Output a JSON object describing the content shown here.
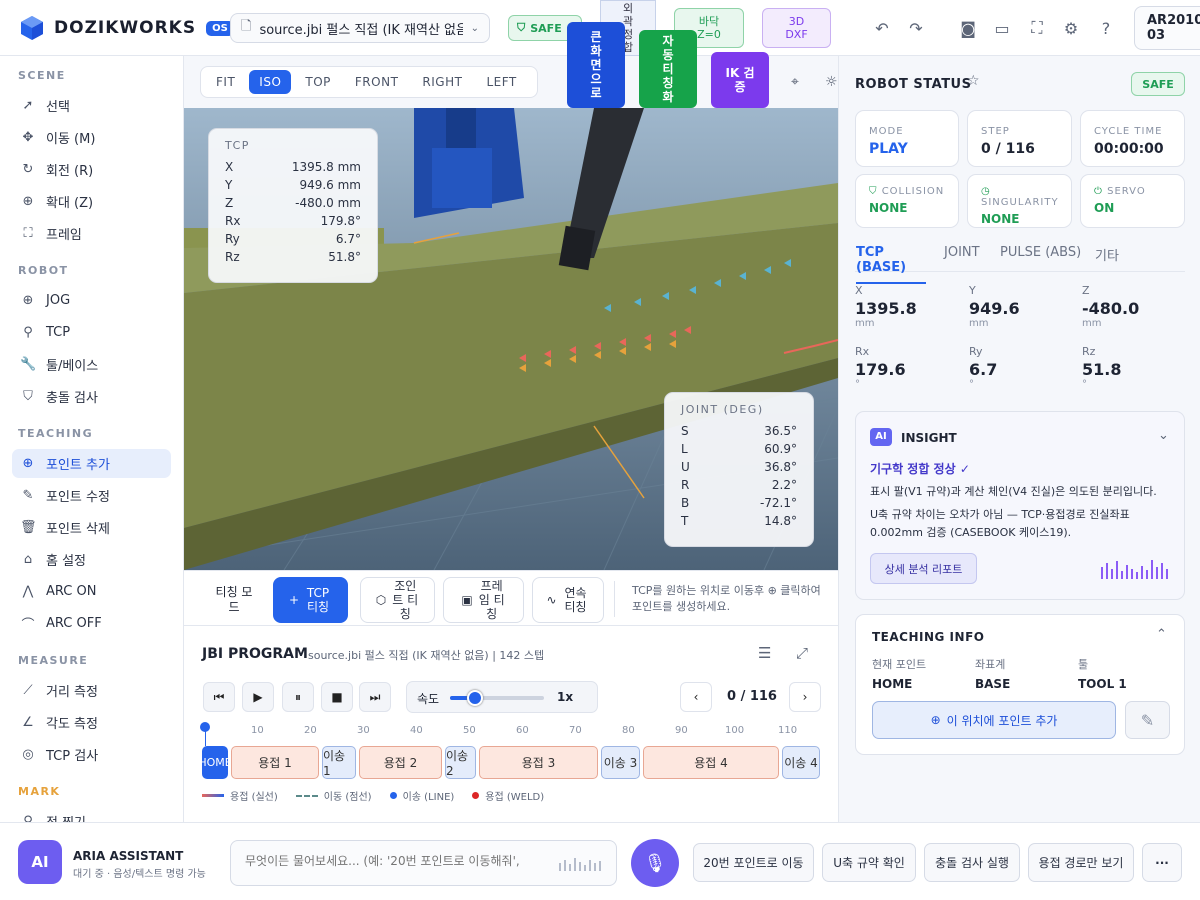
{
  "header": {
    "app_title": "DOZIKWORKS",
    "version": "OS",
    "file_name": "source.jbi 펄스 직접 (IK 재역산 없음)",
    "safe_label": "SAFE",
    "chip_outline": "외곽 정합",
    "chip_floor": "바닥 Z=0",
    "chip_3d": "3D DXF",
    "model": "AR2010 03",
    "float_btn1": "큰화면으로",
    "float_btn2": "자동티칭화",
    "float_btn3": "IK 검증"
  },
  "sidebar": {
    "sections": [
      {
        "title": "SCENE",
        "items": [
          "선택",
          "이동 (M)",
          "회전 (R)",
          "확대 (Z)",
          "프레임"
        ]
      },
      {
        "title": "ROBOT",
        "items": [
          "JOG",
          "TCP",
          "툴/베이스",
          "충돌 검사"
        ]
      },
      {
        "title": "TEACHING",
        "items": [
          "포인트 추가",
          "포인트 수정",
          "포인트 삭제",
          "홈 설정",
          "ARC ON",
          "ARC OFF"
        ]
      },
      {
        "title": "MEASURE",
        "items": [
          "거리 측정",
          "각도 측정",
          "TCP 검사"
        ]
      },
      {
        "title": "MARK",
        "items": [
          "점 찍기"
        ]
      }
    ]
  },
  "viewbar": {
    "items": [
      "FIT",
      "ISO",
      "TOP",
      "FRONT",
      "RIGHT",
      "LEFT"
    ],
    "active": "ISO"
  },
  "tcp_overlay": {
    "title": "TCP",
    "rows": [
      {
        "k": "X",
        "v": "1395.8 mm"
      },
      {
        "k": "Y",
        "v": "949.6 mm"
      },
      {
        "k": "Z",
        "v": "-480.0 mm"
      },
      {
        "k": "Rx",
        "v": "179.8°"
      },
      {
        "k": "Ry",
        "v": "6.7°"
      },
      {
        "k": "Rz",
        "v": "51.8°"
      }
    ]
  },
  "joint_overlay": {
    "title": "JOINT (DEG)",
    "rows": [
      {
        "k": "S",
        "v": "36.5°"
      },
      {
        "k": "L",
        "v": "60.9°"
      },
      {
        "k": "U",
        "v": "36.8°"
      },
      {
        "k": "R",
        "v": "2.2°"
      },
      {
        "k": "B",
        "v": "-72.1°"
      },
      {
        "k": "T",
        "v": "14.8°"
      }
    ]
  },
  "teach_bar": {
    "mode_label": "티칭 모드",
    "tcp_btn": "TCP 티칭",
    "joint_btn": "조인트 티칭",
    "frame_btn": "프레임 티칭",
    "cont_btn": "연속 티칭",
    "hint": "TCP를 원하는 위치로 이동후 ⊕ 클릭하여 포인트를 생성하세요."
  },
  "program": {
    "title": "JBI PROGRAM",
    "subtitle": "source.jbi 펄스 직접 (IK 재역산 없음) | 142 스텝",
    "speed_label": "속도",
    "speed_value": "1x",
    "speed": 0.27,
    "position": "0 / 116",
    "ticks": [
      "10",
      "20",
      "30",
      "40",
      "50",
      "60",
      "70",
      "80",
      "90",
      "100",
      "110"
    ],
    "segments": [
      "HOME",
      "용접 1",
      "이송 1",
      "용접 2",
      "이송 2",
      "용접 3",
      "이송 3",
      "용접 4",
      "이송 4"
    ],
    "legend": [
      "용접 (실선)",
      "이동 (점선)",
      "이송 (LINE)",
      "용접 (WELD)"
    ]
  },
  "robot_status": {
    "title": "ROBOT STATUS",
    "safe": "SAFE",
    "cards": [
      {
        "label": "MODE",
        "value": "PLAY"
      },
      {
        "label": "STEP",
        "value": "0 / 116"
      },
      {
        "label": "CYCLE TIME",
        "value": "00:00:00"
      },
      {
        "label": "COLLISION",
        "value": "NONE"
      },
      {
        "label": "SINGULARITY",
        "value": "NONE"
      },
      {
        "label": "SERVO",
        "value": "ON"
      }
    ],
    "tabs": [
      "TCP (BASE)",
      "JOINT",
      "PULSE (ABS)",
      "기타"
    ],
    "coords": [
      {
        "label": "X",
        "value": "1395.8",
        "unit": "mm"
      },
      {
        "label": "Y",
        "value": "949.6",
        "unit": "mm"
      },
      {
        "label": "Z",
        "value": "-480.0",
        "unit": "mm"
      },
      {
        "label": "Rx",
        "value": "179.6",
        "unit": "°"
      },
      {
        "label": "Ry",
        "value": "6.7",
        "unit": "°"
      },
      {
        "label": "Rz",
        "value": "51.8",
        "unit": "°"
      }
    ]
  },
  "insight": {
    "badge": "AI",
    "title": "INSIGHT",
    "headline": "기구학 정합 정상 ✓",
    "text1": "표시 팔(V1 규약)과 계산 체인(V4 진실)은 의도된 분리입니다.",
    "text2": "U축 규약 차이는 오차가 아님 — TCP·용접경로 진실좌표 0.002mm 검증 (CASEBOOK 케이스19).",
    "button": "상세 분석 리포트"
  },
  "teaching_info": {
    "title": "TEACHING INFO",
    "cols": [
      {
        "label": "현재 포인트",
        "value": "HOME"
      },
      {
        "label": "좌표계",
        "value": "BASE"
      },
      {
        "label": "툴",
        "value": "TOOL 1"
      }
    ],
    "add_button": "이 위치에 포인트 추가"
  },
  "assistant": {
    "badge": "AI",
    "name": "ARIA ASSISTANT",
    "status": "대기 중 · 음성/텍스트 명령 가능",
    "placeholder": "무엇이든 물어보세요... (예: '20번 포인트로 이동해줘',",
    "quick": [
      "20번 포인트로 이동",
      "U축 규약 확인",
      "충돌 검사 실행",
      "용접 경로만 보기"
    ],
    "more": "···"
  },
  "colors": {
    "accent": "#2563eb",
    "safe": "#1f9d55",
    "weld": "#e8a794",
    "move": "#9fb6e3",
    "beam": "#8f9a5c"
  }
}
